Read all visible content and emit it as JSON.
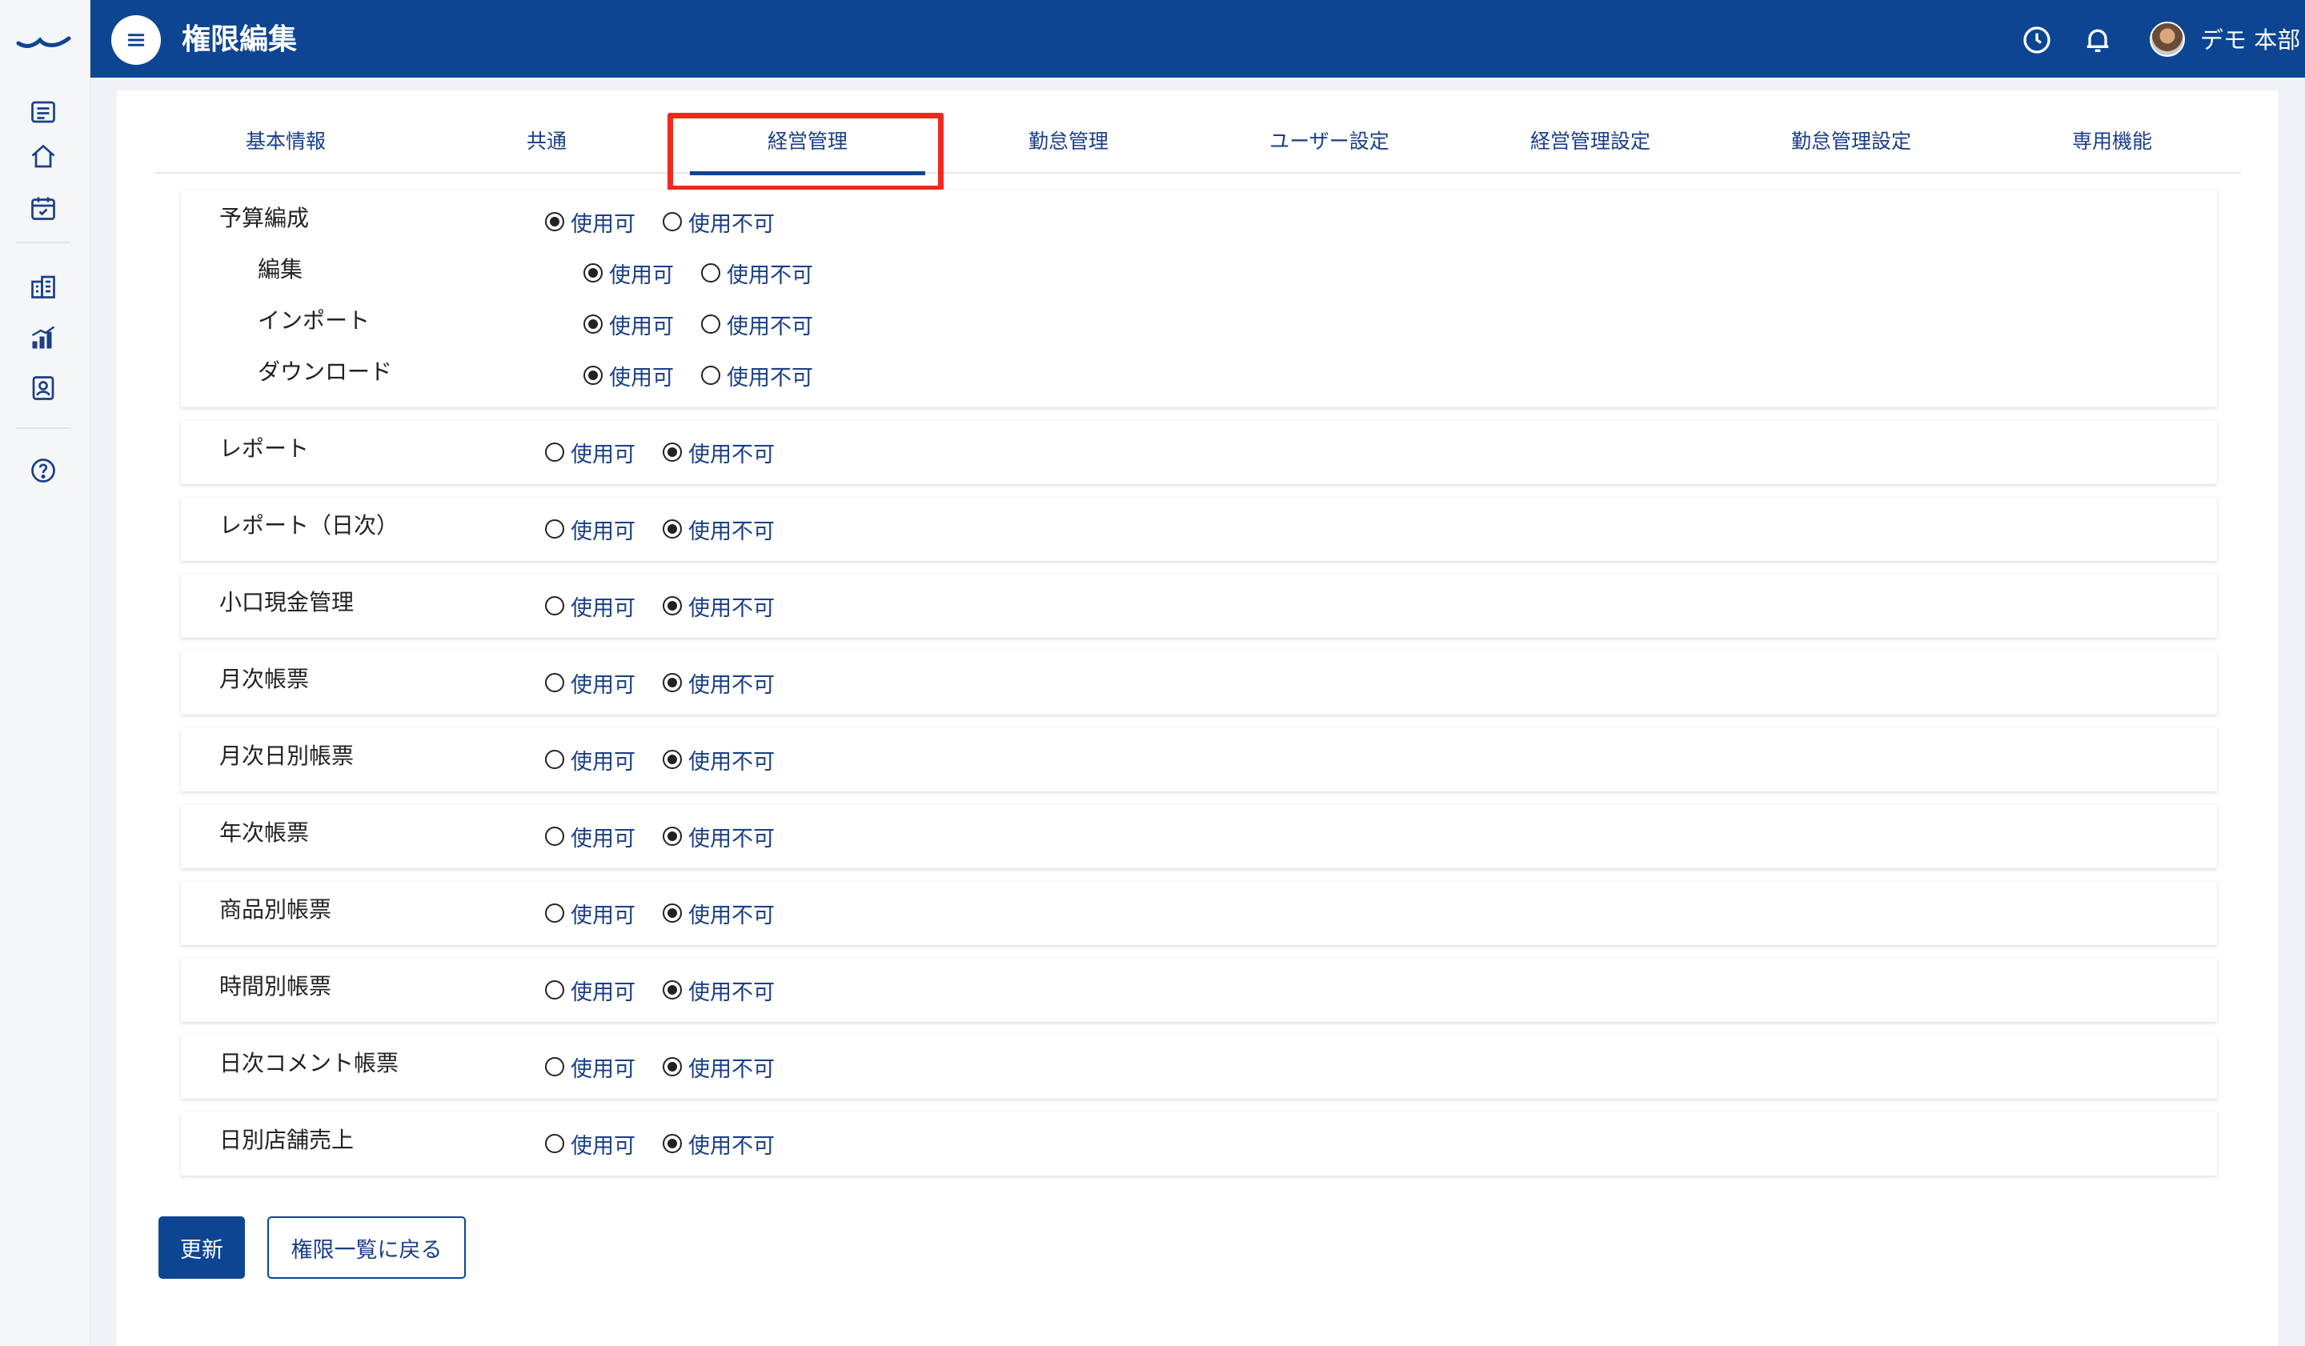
{
  "header": {
    "title": "権限編集",
    "user_name": "デモ 本部"
  },
  "tabs": [
    {
      "label": "基本情報"
    },
    {
      "label": "共通"
    },
    {
      "label": "経営管理",
      "active": true
    },
    {
      "label": "勤怠管理"
    },
    {
      "label": "ユーザー設定"
    },
    {
      "label": "経営管理設定"
    },
    {
      "label": "勤怠管理設定"
    },
    {
      "label": "専用機能"
    }
  ],
  "options": {
    "allow": "使用可",
    "deny": "使用不可"
  },
  "permissions": [
    {
      "label": "予算編成",
      "value": "allow",
      "children": [
        {
          "label": "編集",
          "value": "allow"
        },
        {
          "label": "インポート",
          "value": "allow"
        },
        {
          "label": "ダウンロード",
          "value": "allow"
        }
      ]
    },
    {
      "label": "レポート",
      "value": "deny"
    },
    {
      "label": "レポート（日次）",
      "value": "deny"
    },
    {
      "label": "小口現金管理",
      "value": "deny"
    },
    {
      "label": "月次帳票",
      "value": "deny"
    },
    {
      "label": "月次日別帳票",
      "value": "deny"
    },
    {
      "label": "年次帳票",
      "value": "deny"
    },
    {
      "label": "商品別帳票",
      "value": "deny"
    },
    {
      "label": "時間別帳票",
      "value": "deny"
    },
    {
      "label": "日次コメント帳票",
      "value": "deny"
    },
    {
      "label": "日別店舗売上",
      "value": "deny"
    }
  ],
  "buttons": {
    "update": "更新",
    "back": "権限一覧に戻る"
  },
  "colors": {
    "primary": "#0d4593",
    "highlight": "#f0281e",
    "link": "#1a3f86"
  },
  "icons": [
    "logo-icon",
    "list-icon",
    "home-icon",
    "calendar-check-icon",
    "building-icon",
    "bar-chart-icon",
    "id-badge-icon",
    "help-icon",
    "menu-icon",
    "clock-icon",
    "bell-icon"
  ]
}
